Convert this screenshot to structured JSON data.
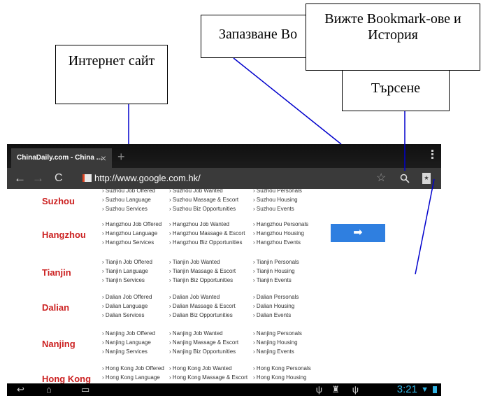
{
  "callouts": {
    "site": "Интернет сайт",
    "saved": "Запазване Bo",
    "search": "Търсене",
    "bookmarks": "Вижте Bookmark-ове и История"
  },
  "tab": {
    "title": "ChinaDaily.com - China ...",
    "close": "×",
    "new_tab": "+"
  },
  "toolbar": {
    "back": "←",
    "forward": "→",
    "reload": "C",
    "url": "http://www.google.com.hk/",
    "star": "☆"
  },
  "cities": [
    {
      "name": "Suzhou",
      "col1": [
        "› Suzhou Job Offered",
        "› Suzhou Language",
        "› Suzhou Services"
      ],
      "col2": [
        "› Suzhou Job Wanted",
        "› Suzhou Massage & Escort",
        "› Suzhou Biz Opportunities"
      ],
      "col3": [
        "› Suzhou Personals",
        "› Suzhou Housing",
        "› Suzhou Events"
      ]
    },
    {
      "name": "Hangzhou",
      "col1": [
        "› Hangzhou Job Offered",
        "› Hangzhou Language",
        "› Hangzhou Services"
      ],
      "col2": [
        "› Hangzhou Job Wanted",
        "› Hangzhou Massage & Escort",
        "› Hangzhou Biz Opportunities"
      ],
      "col3": [
        "› Hangzhou Personals",
        "› Hangzhou Housing",
        "› Hangzhou Events"
      ]
    },
    {
      "name": "Tianjin",
      "col1": [
        "› Tianjin Job Offered",
        "› Tianjin Language",
        "› Tianjin Services"
      ],
      "col2": [
        "› Tianjin Job Wanted",
        "› Tianjin Massage & Escort",
        "› Tianjin Biz Opportunities"
      ],
      "col3": [
        "› Tianjin Personals",
        "› Tianjin Housing",
        "› Tianjin Events"
      ]
    },
    {
      "name": "Dalian",
      "col1": [
        "› Dalian Job Offered",
        "› Dalian Language",
        "› Dalian Services"
      ],
      "col2": [
        "› Dalian Job Wanted",
        "› Dalian Massage & Escort",
        "› Dalian Biz Opportunities"
      ],
      "col3": [
        "› Dalian Personals",
        "› Dalian Housing",
        "› Dalian Events"
      ]
    },
    {
      "name": "Nanjing",
      "col1": [
        "› Nanjing Job Offered",
        "› Nanjing Language",
        "› Nanjing Services"
      ],
      "col2": [
        "› Nanjing Job Wanted",
        "› Nanjing Massage & Escort",
        "› Nanjing Biz Opportunities"
      ],
      "col3": [
        "› Nanjing Personals",
        "› Nanjing Housing",
        "› Nanjing Events"
      ]
    },
    {
      "name": "Hong Kong",
      "col1": [
        "› Hong Kong Job Offered",
        "› Hong Kong Language",
        ""
      ],
      "col2": [
        "› Hong Kong Job Wanted",
        "› Hong Kong Massage & Escort",
        ""
      ],
      "col3": [
        "› Hong Kong Personals",
        "› Hong Kong Housing",
        ""
      ]
    }
  ],
  "arrow_button": "➡",
  "statusbar": {
    "clock": "3:21",
    "back": "↩",
    "home": "⌂",
    "recent": "▭",
    "usb1": "ψ",
    "android": "♜",
    "usb2": "ψ",
    "wifi": "▼"
  },
  "colors": {
    "city_red": "#cc2222",
    "accent_blue": "#33b5e5",
    "button_blue": "#2f7fe0",
    "callout_line": "#0000cc"
  }
}
